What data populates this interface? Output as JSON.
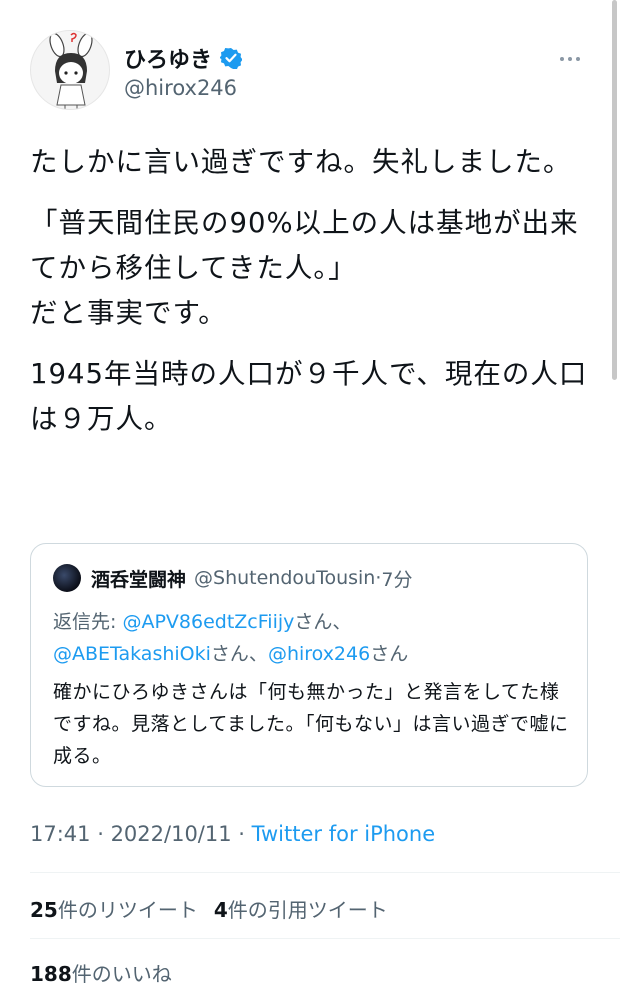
{
  "author": {
    "display_name": "ひろゆき",
    "handle": "@hirox246",
    "verified": true,
    "avatar_icon": "avatar-icon"
  },
  "tweet": {
    "paragraphs": [
      "たしかに言い過ぎですね。失礼しました。",
      "「普天間住民の90%以上の人は基地が出来てから移住してきた人。」\nだと事実です。",
      "1945年当時の人口が９千人で、現在の人口は９万人。"
    ]
  },
  "quote": {
    "name": "酒呑堂闘神",
    "handle": "@ShutendouTousin",
    "time": "7分",
    "reply_prefix": "返信先: ",
    "reply_user1": "@APV86edtZcFiijy",
    "reply_user2": "@ABETakashiOki",
    "reply_user3": "@hirox246",
    "reply_san": "さん",
    "reply_sep": "さん、",
    "body": "確かにひろゆきさんは「何も無かった」と発言をしてた様ですね。見落としてました。「何もない」は言い過ぎで嘘に成る。"
  },
  "meta": {
    "time": "17:41",
    "date": "2022/10/11",
    "source": "Twitter for iPhone"
  },
  "stats": {
    "retweets_count": "25",
    "retweets_label": "件のリツイート",
    "quotes_count": "4",
    "quotes_label": "件の引用ツイート",
    "likes_count": "188",
    "likes_label": "件のいいね"
  },
  "colors": {
    "link": "#1d9bf0",
    "text": "#0f1419",
    "secondary": "#536471",
    "border": "#cfd9de"
  }
}
